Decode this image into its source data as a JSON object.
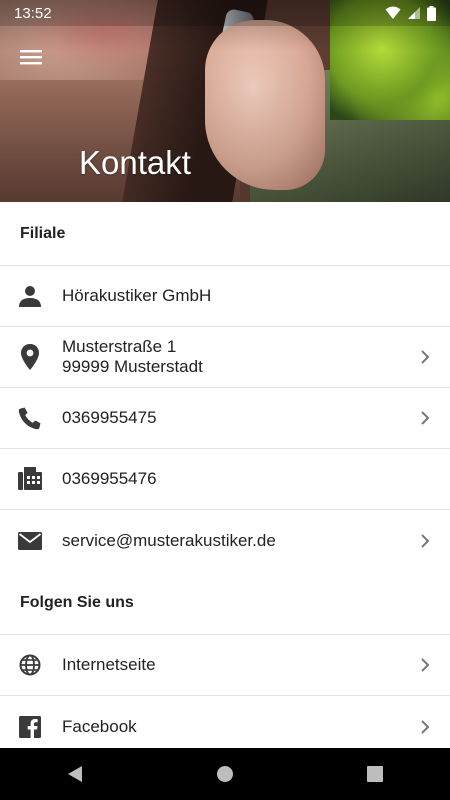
{
  "status_bar": {
    "time": "13:52"
  },
  "header": {
    "title": "Kontakt"
  },
  "sections": {
    "filiale": {
      "title": "Filiale",
      "name": "Hörakustiker GmbH",
      "address_line1": "Musterstraße 1",
      "address_line2": "99999 Musterstadt",
      "phone": "0369955475",
      "fax": "0369955476",
      "email": "service@musterakustiker.de"
    },
    "follow": {
      "title": "Folgen Sie uns",
      "website": "Internetseite",
      "facebook": "Facebook"
    }
  },
  "icons": {
    "menu": "hamburger-menu-icon",
    "person": "person-icon",
    "location": "location-pin-icon",
    "phone": "phone-icon",
    "fax": "fax-icon",
    "email": "envelope-icon",
    "globe": "globe-icon",
    "facebook": "facebook-icon",
    "chevron": "chevron-right-icon"
  },
  "colors": {
    "icon": "#3a3a3a",
    "chevron": "#777777",
    "divider": "#e2e2e2",
    "nav_bar": "#000000"
  }
}
